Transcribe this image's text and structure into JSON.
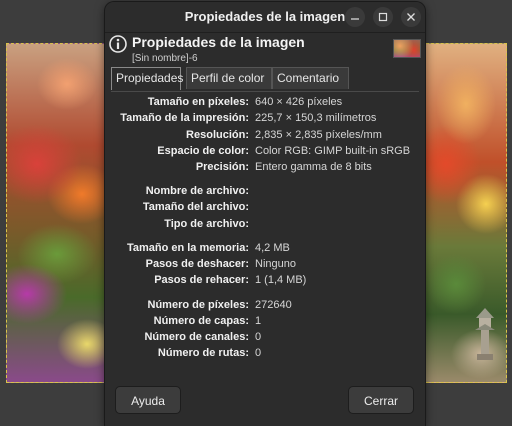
{
  "window": {
    "title": "Propiedades de la imagen"
  },
  "header": {
    "title": "Propiedades de la imagen",
    "subtitle": "[Sin nombre]-6"
  },
  "tabs": [
    {
      "label": "Propiedades",
      "active": true
    },
    {
      "label": "Perfil de color",
      "active": false
    },
    {
      "label": "Comentario",
      "active": false
    }
  ],
  "properties": [
    {
      "key": "Tamaño en píxeles:",
      "value": "640 × 426 píxeles"
    },
    {
      "key": "Tamaño de la impresión:",
      "value": "225,7 × 150,3 milímetros"
    },
    {
      "key": "Resolución:",
      "value": "2,835 × 2,835 píxeles/mm"
    },
    {
      "key": "Espacio de color:",
      "value": "Color RGB: GIMP built-in sRGB"
    },
    {
      "key": "Precisión:",
      "value": "Entero gamma de 8 bits"
    },
    {
      "key": "Nombre de archivo:",
      "value": ""
    },
    {
      "key": "Tamaño del archivo:",
      "value": ""
    },
    {
      "key": "Tipo de archivo:",
      "value": ""
    },
    {
      "key": "Tamaño en la memoria:",
      "value": "4,2 MB"
    },
    {
      "key": "Pasos de deshacer:",
      "value": "Ninguno"
    },
    {
      "key": "Pasos de rehacer:",
      "value": "1 (1,4 MB)"
    },
    {
      "key": "Número de píxeles:",
      "value": "272640"
    },
    {
      "key": "Número de capas:",
      "value": "1"
    },
    {
      "key": "Número de canales:",
      "value": "0"
    },
    {
      "key": "Número de rutas:",
      "value": "0"
    }
  ],
  "buttons": {
    "help": "Ayuda",
    "close": "Cerrar"
  },
  "icons": {
    "info": "info-icon",
    "minimize": "minimize-icon",
    "maximize": "maximize-icon",
    "close": "close-icon"
  },
  "colors": {
    "dialog_bg": "#2c2c2c",
    "canvas_border": "#d9c34a"
  }
}
